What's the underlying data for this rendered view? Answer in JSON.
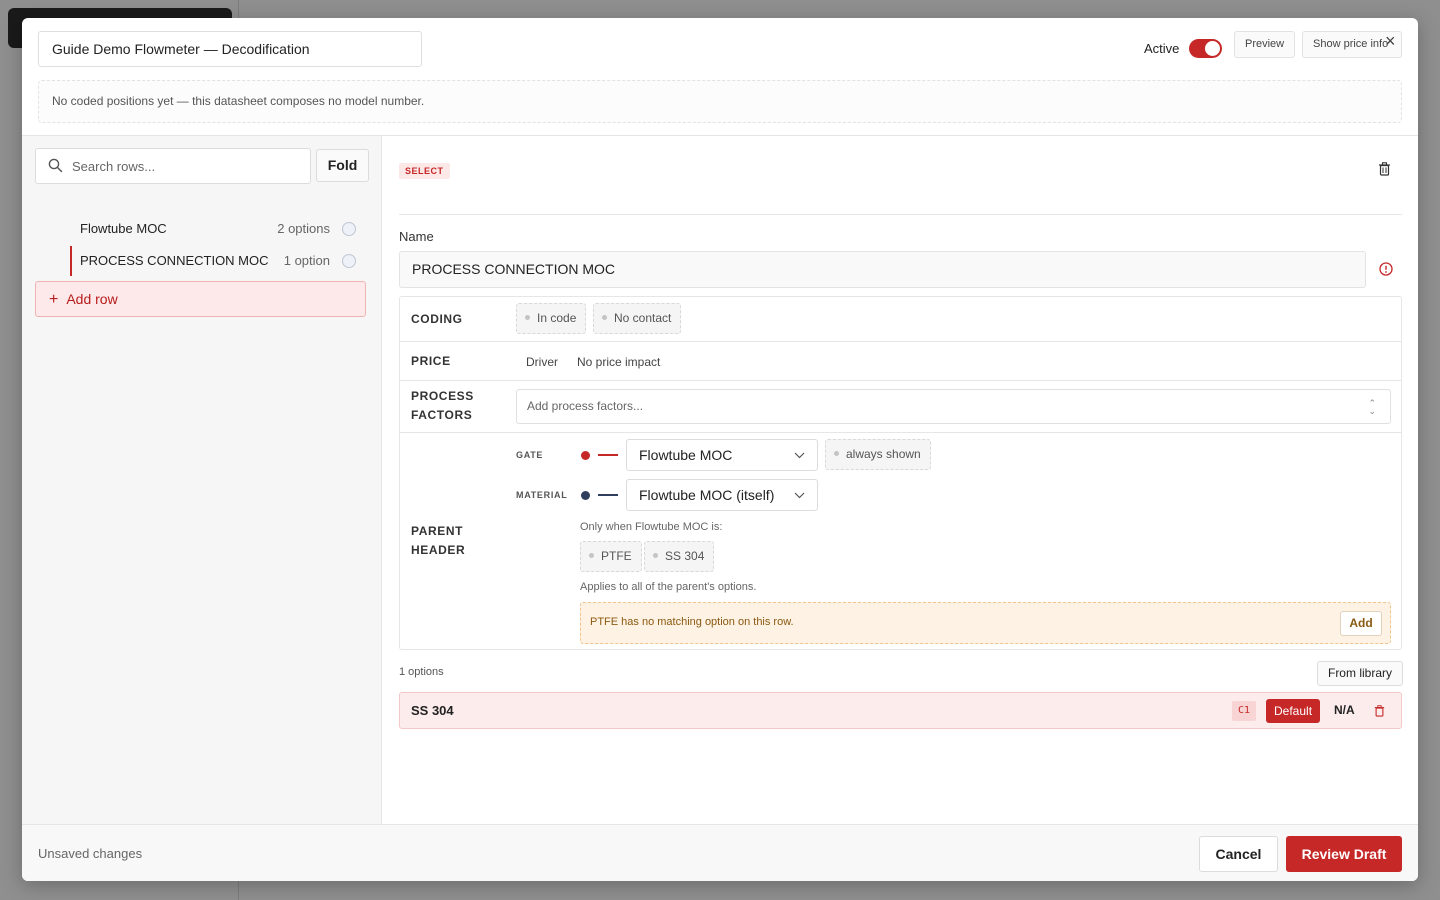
{
  "header": {
    "title_value": "Guide Demo Flowmeter — Decodification",
    "active_label": "Active",
    "active": true,
    "preview_label": "Preview",
    "show_price_label": "Show price info",
    "close_glyph": "×"
  },
  "notice": "No coded positions yet — this datasheet composes no model number.",
  "sidebar": {
    "search_placeholder": "Search rows...",
    "fold_label": "Fold",
    "rows": [
      {
        "label": "Flowtube MOC",
        "count": "2 options"
      },
      {
        "label": "PROCESS CONNECTION MOC",
        "count": "1 option",
        "selected": true
      }
    ],
    "add_row_label": "Add row"
  },
  "detail": {
    "type_badge": "SELECT",
    "name_label": "Name",
    "name_value": "PROCESS CONNECTION MOC",
    "coding": {
      "label": "CODING",
      "chips": [
        "In code",
        "No contact"
      ]
    },
    "price": {
      "label": "PRICE",
      "driver": "Driver",
      "impact": "No price impact"
    },
    "process_factors": {
      "label_line1": "PROCESS",
      "label_line2": "FACTORS",
      "placeholder": "Add process factors..."
    },
    "parent_header": {
      "label_line1": "PARENT",
      "label_line2": "HEADER",
      "gate_label": "GATE",
      "gate_value": "Flowtube MOC",
      "gate_chip": "always shown",
      "gate_color": "#c62828",
      "material_label": "MATERIAL",
      "material_value": "Flowtube MOC (itself)",
      "material_color": "#2e3e5c",
      "only_when": "Only when Flowtube MOC is:",
      "conditions": [
        "PTFE",
        "SS 304"
      ],
      "applies": "Applies to all of the parent's options.",
      "warning": "PTFE has no matching option on this row.",
      "warning_add": "Add"
    },
    "options_count": "1 options",
    "from_library": "From library",
    "options": [
      {
        "name": "SS 304",
        "code": "C1",
        "default_label": "Default",
        "price": "N/A"
      }
    ]
  },
  "footer": {
    "status": "Unsaved changes",
    "cancel_label": "Cancel",
    "review_label": "Review Draft"
  },
  "colors": {
    "accent": "#c62828",
    "accent_soft": "#fdecec"
  }
}
